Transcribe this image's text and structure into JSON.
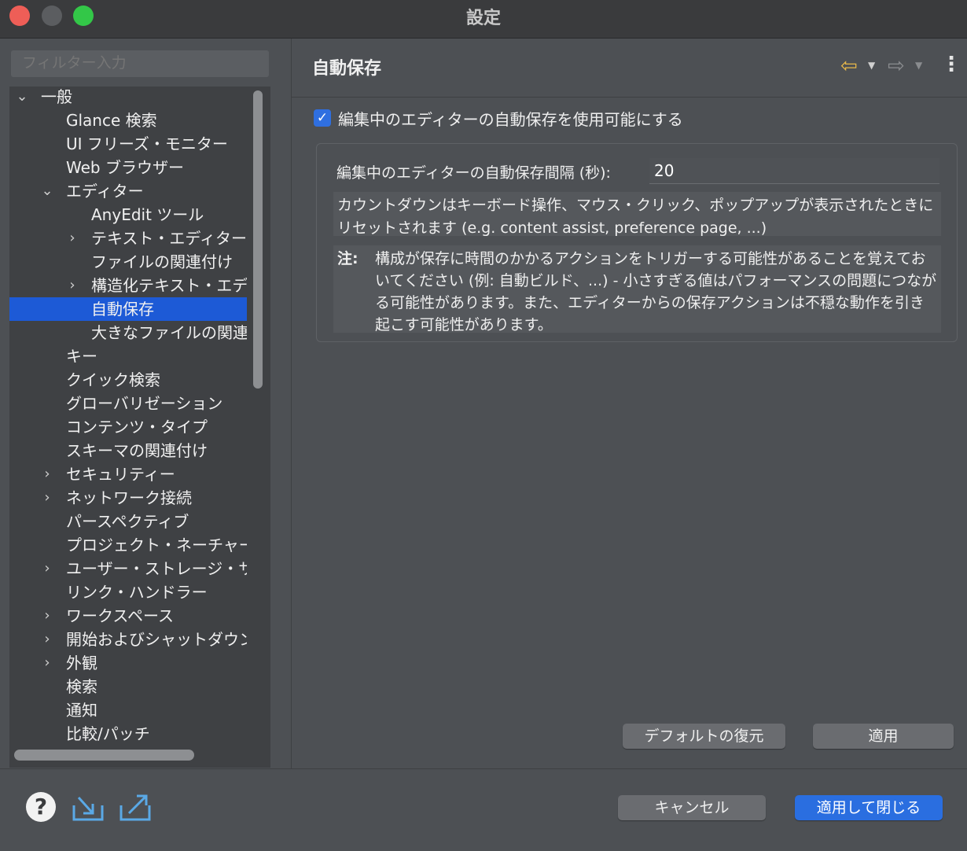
{
  "window": {
    "title": "設定"
  },
  "filter": {
    "placeholder": "フィルター入力"
  },
  "tree": [
    {
      "label": "一般",
      "level": 0,
      "expander": "expanded"
    },
    {
      "label": "Glance 検索",
      "level": 1,
      "expander": "none"
    },
    {
      "label": "UI フリーズ・モニター",
      "level": 1,
      "expander": "none"
    },
    {
      "label": "Web ブラウザー",
      "level": 1,
      "expander": "none"
    },
    {
      "label": "エディター",
      "level": 1,
      "expander": "expanded"
    },
    {
      "label": "AnyEdit ツール",
      "level": 2,
      "expander": "none"
    },
    {
      "label": "テキスト・エディター",
      "level": 2,
      "expander": "collapsed"
    },
    {
      "label": "ファイルの関連付け",
      "level": 2,
      "expander": "none"
    },
    {
      "label": "構造化テキスト・エディ",
      "level": 2,
      "expander": "collapsed"
    },
    {
      "label": "自動保存",
      "level": 2,
      "expander": "none",
      "selected": true
    },
    {
      "label": "大きなファイルの関連",
      "level": 2,
      "expander": "none"
    },
    {
      "label": "キー",
      "level": 1,
      "expander": "none"
    },
    {
      "label": "クイック検索",
      "level": 1,
      "expander": "none"
    },
    {
      "label": "グローバリゼーション",
      "level": 1,
      "expander": "none"
    },
    {
      "label": "コンテンツ・タイプ",
      "level": 1,
      "expander": "none"
    },
    {
      "label": "スキーマの関連付け",
      "level": 1,
      "expander": "none"
    },
    {
      "label": "セキュリティー",
      "level": 1,
      "expander": "collapsed"
    },
    {
      "label": "ネットワーク接続",
      "level": 1,
      "expander": "collapsed"
    },
    {
      "label": "パースペクティブ",
      "level": 1,
      "expander": "none"
    },
    {
      "label": "プロジェクト・ネーチャー",
      "level": 1,
      "expander": "none"
    },
    {
      "label": "ユーザー・ストレージ・サ",
      "level": 1,
      "expander": "collapsed"
    },
    {
      "label": "リンク・ハンドラー",
      "level": 1,
      "expander": "none"
    },
    {
      "label": "ワークスペース",
      "level": 1,
      "expander": "collapsed"
    },
    {
      "label": "開始およびシャットダウン",
      "level": 1,
      "expander": "collapsed"
    },
    {
      "label": "外観",
      "level": 1,
      "expander": "collapsed"
    },
    {
      "label": "検索",
      "level": 1,
      "expander": "none"
    },
    {
      "label": "通知",
      "level": 1,
      "expander": "none"
    },
    {
      "label": "比較/パッチ",
      "level": 1,
      "expander": "none"
    }
  ],
  "page": {
    "title": "自動保存",
    "enable_label": "編集中のエディターの自動保存を使用可能にする",
    "enable_checked": true,
    "interval_label": "編集中のエディターの自動保存間隔 (秒):",
    "interval_value": "20",
    "info_text": "カウントダウンはキーボード操作、マウス・クリック、ポップアップが表示されたときにリセットされます (e.g. content assist, preference page, ...)",
    "note_label": "注:",
    "note_text": "構成が保存に時間のかかるアクションをトリガーする可能性があることを覚えておいてください (例: 自動ビルド、...) - 小さすぎる値はパフォーマンスの問題につながる可能性があります。また、エディターからの保存アクションは不穏な動作を引き起こす可能性があります。",
    "restore_defaults": "デフォルトの復元",
    "apply": "適用"
  },
  "footer": {
    "cancel": "キャンセル",
    "apply_and_close": "適用して閉じる"
  },
  "colors": {
    "selection": "#1d5ad6",
    "primary_button": "#2a6ee0",
    "back_arrow": "#e7b84a"
  }
}
